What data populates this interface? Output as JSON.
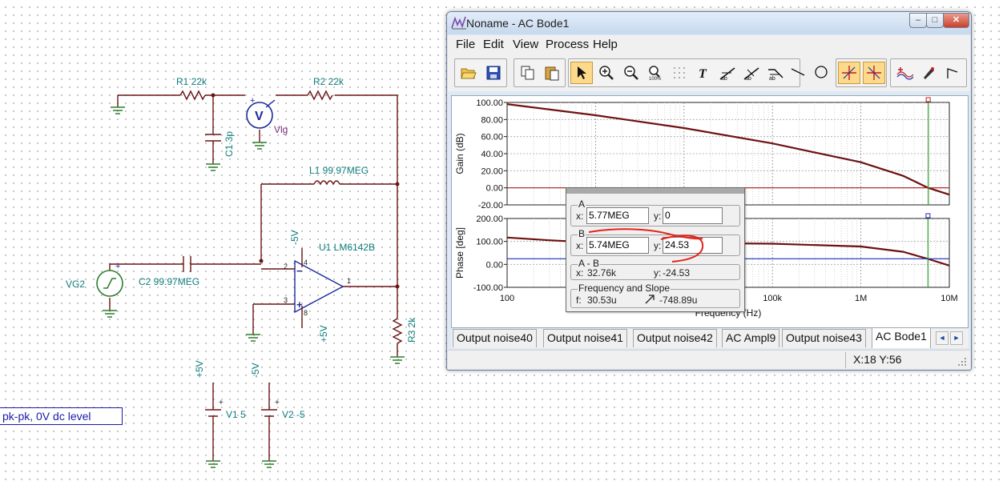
{
  "window": {
    "title": "Noname - AC Bode1",
    "minimize_glyph": "‒",
    "maximize_glyph": "□",
    "close_glyph": "✕"
  },
  "menu": [
    "File",
    "Edit",
    "View",
    "Process",
    "Help"
  ],
  "toolbar_icons": [
    "open-icon",
    "save-icon",
    "copy-icon",
    "paste-icon",
    "pointer-icon",
    "zoom-in-icon",
    "zoom-out-icon",
    "zoom-100-icon",
    "grid-icon",
    "text-icon",
    "cursor-a-icon",
    "cursor-b-icon",
    "cursor-c-icon",
    "line-icon",
    "circle-icon",
    "cursor-marker-icon",
    "cursor-marker-2-icon",
    "curves-icon",
    "pen-icon",
    "arrow-icon"
  ],
  "cursor_panel": {
    "group_a": {
      "legend": "A",
      "x_label": "x:",
      "x_value": "5.77MEG",
      "y_label": "y:",
      "y_value": "0"
    },
    "group_b": {
      "legend": "B",
      "x_label": "x:",
      "x_value": "5.74MEG",
      "y_label": "y:",
      "y_value": "24.53"
    },
    "group_ab": {
      "legend": "A - B",
      "x_label": "x:",
      "x_value": "32.76k",
      "y_label": "y:",
      "y_value": "-24.53"
    },
    "group_slope": {
      "legend": "Frequency and Slope",
      "f_label": "f:",
      "f_value": "30.53u",
      "slope_value": "-748.89u"
    }
  },
  "tabs": [
    {
      "label": "Output noise40"
    },
    {
      "label": "Output noise41"
    },
    {
      "label": "Output noise42"
    },
    {
      "label": "AC Ampl9"
    },
    {
      "label": "Output noise43"
    },
    {
      "label": "AC Bode1"
    }
  ],
  "tab_scroll": {
    "left": "◄",
    "right": "►"
  },
  "status": {
    "coords": "X:18  Y:56"
  },
  "chart_data": [
    {
      "type": "line",
      "title": "",
      "ylabel": "Gain (dB)",
      "xlabel": "",
      "x_scale": "log",
      "xlim": [
        100,
        10000000
      ],
      "ylim": [
        -20,
        100
      ],
      "y_ticks": [
        "100.00",
        "80.00",
        "60.00",
        "40.00",
        "20.00",
        "0.00",
        "-20.00"
      ],
      "series": [
        {
          "color": "#6e1111",
          "x": [
            100,
            1000,
            10000,
            100000,
            1000000,
            3000000,
            5770000,
            10000000
          ],
          "y": [
            98,
            85,
            70,
            52,
            30,
            14,
            0,
            -8
          ]
        },
        {
          "color": "#b01e1e",
          "x": [
            100,
            10000000
          ],
          "y": [
            0,
            0
          ]
        }
      ],
      "cursors": [
        {
          "x": 5770000,
          "color": "#2e9e2e"
        }
      ],
      "grid": true
    },
    {
      "type": "line",
      "title": "",
      "ylabel": "Phase [deg]",
      "xlabel": "Frequency (Hz)",
      "x_scale": "log",
      "xlim": [
        100,
        10000000
      ],
      "ylim": [
        -100,
        200
      ],
      "y_ticks": [
        "200.00",
        "100.00",
        "0.00",
        "-100.00"
      ],
      "x_ticks": [
        "100",
        "1k",
        "10k",
        "100k",
        "1M",
        "10M"
      ],
      "series": [
        {
          "color": "#6e1111",
          "x": [
            100,
            300,
            1000,
            10000,
            100000,
            1000000,
            3000000,
            5740000,
            10000000
          ],
          "y": [
            117,
            105,
            95,
            93,
            90,
            78,
            55,
            24,
            -5
          ]
        },
        {
          "color": "#1f2fbf",
          "x": [
            100,
            10000000
          ],
          "y": [
            24.53,
            24.53
          ]
        }
      ],
      "cursors": [
        {
          "x": 5740000,
          "color": "#2e9e2e"
        }
      ],
      "grid": true
    }
  ],
  "schematic": {
    "labels": {
      "r1": "R1 22k",
      "r2": "R2 22k",
      "c1": "C1 3p",
      "vlg": "Vlg",
      "vm": "V",
      "l1": "L1 99.97MEG",
      "u1": "U1 LM6142B",
      "minus5_top": "-5V",
      "plus5_bot": "+5V",
      "vg2": "VG2",
      "c2": "C2 99.97MEG",
      "r3": "R3 2k",
      "v1_rail": "+5V",
      "v2_rail": "-5V",
      "v1": "V1 5",
      "v2": "V2 -5",
      "pin2": "2",
      "pin3": "3",
      "pin1": "1",
      "pin4": "4",
      "pin8": "8",
      "plus": "+",
      "minus": "−"
    },
    "note": "pk-pk, 0V dc level"
  }
}
